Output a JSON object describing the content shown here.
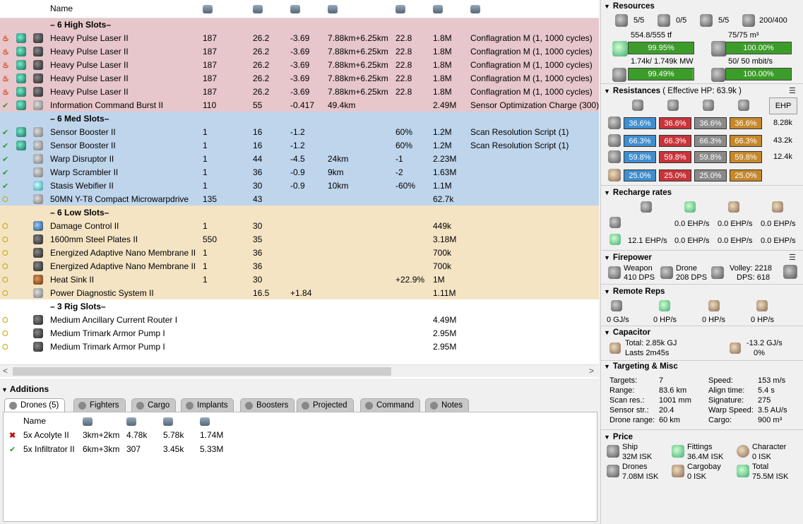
{
  "fit": {
    "columns": {
      "name": "Name"
    },
    "sections": {
      "high": "– 6 High Slots–",
      "med": "– 6 Med Slots–",
      "low": "– 6 Low Slots–",
      "rig": "– 3 Rig Slots–"
    },
    "high_rows": [
      {
        "state": "over",
        "name": "Heavy Pulse Laser II",
        "c1": "187",
        "c2": "26.2",
        "c3": "-3.69",
        "c4": "7.88km+6.25km",
        "c5": "22.8",
        "c6": "1.8M",
        "charge": "Conflagration M (1, 1000 cycles)"
      },
      {
        "state": "over",
        "name": "Heavy Pulse Laser II",
        "c1": "187",
        "c2": "26.2",
        "c3": "-3.69",
        "c4": "7.88km+6.25km",
        "c5": "22.8",
        "c6": "1.8M",
        "charge": "Conflagration M (1, 1000 cycles)"
      },
      {
        "state": "over",
        "name": "Heavy Pulse Laser II",
        "c1": "187",
        "c2": "26.2",
        "c3": "-3.69",
        "c4": "7.88km+6.25km",
        "c5": "22.8",
        "c6": "1.8M",
        "charge": "Conflagration M (1, 1000 cycles)"
      },
      {
        "state": "over",
        "name": "Heavy Pulse Laser II",
        "c1": "187",
        "c2": "26.2",
        "c3": "-3.69",
        "c4": "7.88km+6.25km",
        "c5": "22.8",
        "c6": "1.8M",
        "charge": "Conflagration M (1, 1000 cycles)"
      },
      {
        "state": "over",
        "name": "Heavy Pulse Laser II",
        "c1": "187",
        "c2": "26.2",
        "c3": "-3.69",
        "c4": "7.88km+6.25km",
        "c5": "22.8",
        "c6": "1.8M",
        "charge": "Conflagration M (1, 1000 cycles)"
      },
      {
        "state": "on",
        "name": "Information Command Burst II",
        "c1": "110",
        "c2": "55",
        "c3": "-0.417",
        "c4": "49.4km",
        "c5": "",
        "c6": "2.49M",
        "charge": "Sensor Optimization Charge (300)"
      }
    ],
    "med_rows": [
      {
        "state": "on",
        "name": "Sensor Booster II",
        "c1": "1",
        "c2": "16",
        "c3": "-1.2",
        "c4": "",
        "c5": "60%",
        "c6": "1.2M",
        "charge": "Scan Resolution Script (1)"
      },
      {
        "state": "on",
        "name": "Sensor Booster II",
        "c1": "1",
        "c2": "16",
        "c3": "-1.2",
        "c4": "",
        "c5": "60%",
        "c6": "1.2M",
        "charge": "Scan Resolution Script (1)"
      },
      {
        "state": "on",
        "name": "Warp Disruptor II",
        "c1": "1",
        "c2": "44",
        "c3": "-4.5",
        "c4": "24km",
        "c5": "-1",
        "c6": "2.23M",
        "charge": ""
      },
      {
        "state": "on",
        "name": "Warp Scrambler II",
        "c1": "1",
        "c2": "36",
        "c3": "-0.9",
        "c4": "9km",
        "c5": "-2",
        "c6": "1.63M",
        "charge": ""
      },
      {
        "state": "on",
        "name": "Stasis Webifier II",
        "c1": "1",
        "c2": "30",
        "c3": "-0.9",
        "c4": "10km",
        "c5": "-60%",
        "c6": "1.1M",
        "charge": ""
      },
      {
        "state": "off",
        "name": "50MN Y-T8 Compact Microwarpdrive",
        "c1": "135",
        "c2": "43",
        "c3": "",
        "c4": "",
        "c5": "",
        "c6": "62.7k",
        "charge": ""
      }
    ],
    "low_rows": [
      {
        "state": "off",
        "name": "Damage Control II",
        "c1": "1",
        "c2": "30",
        "c3": "",
        "c4": "",
        "c5": "",
        "c6": "449k"
      },
      {
        "state": "off",
        "name": "1600mm Steel Plates II",
        "c1": "550",
        "c2": "35",
        "c3": "",
        "c4": "",
        "c5": "",
        "c6": "3.18M"
      },
      {
        "state": "off",
        "name": "Energized Adaptive Nano Membrane II",
        "c1": "1",
        "c2": "36",
        "c3": "",
        "c4": "",
        "c5": "",
        "c6": "700k"
      },
      {
        "state": "off",
        "name": "Energized Adaptive Nano Membrane II",
        "c1": "1",
        "c2": "36",
        "c3": "",
        "c4": "",
        "c5": "",
        "c6": "700k"
      },
      {
        "state": "off",
        "name": "Heat Sink II",
        "c1": "1",
        "c2": "30",
        "c3": "",
        "c4": "",
        "c5": "+22.9%",
        "c6": "1M"
      },
      {
        "state": "off",
        "name": "Power Diagnostic System II",
        "c1": "",
        "c2": "16.5",
        "c3": "+1.84",
        "c4": "",
        "c5": "",
        "c6": "1.11M"
      }
    ],
    "rig_rows": [
      {
        "state": "off",
        "name": "Medium Ancillary Current Router I",
        "c6": "4.49M"
      },
      {
        "state": "off",
        "name": "Medium Trimark Armor Pump I",
        "c6": "2.95M"
      },
      {
        "state": "off",
        "name": "Medium Trimark Armor Pump I",
        "c6": "2.95M"
      }
    ]
  },
  "additions": {
    "title": "Additions",
    "tabs": [
      "Drones (5)",
      "Fighters",
      "Cargo",
      "Implants",
      "Boosters",
      "Projected",
      "Command",
      "Notes"
    ],
    "drone_header": "Name",
    "drones": [
      {
        "state": "x",
        "name": "5x Acolyte II",
        "range": "3km+2km",
        "v1": "4.78k",
        "v2": "5.78k",
        "price": "1.74M"
      },
      {
        "state": "on",
        "name": "5x Infiltrator II",
        "range": "6km+3km",
        "v1": "307",
        "v2": "3.45k",
        "price": "5.33M"
      }
    ]
  },
  "resources": {
    "title": "Resources",
    "turrets": "5/5",
    "launchers": "0/5",
    "calibration": "5/5",
    "drone_bay": "200/400",
    "cpu_text": "554.8/555 tf",
    "cpu_pct": "99.95%",
    "cpu_fill": 0.9995,
    "bandwidth_text": "75/75 m³",
    "bandwidth_pct": "100.00%",
    "bandwidth_fill": 1.0,
    "pg_text": "1.74k/ 1.749k MW",
    "pg_pct": "99.49%",
    "pg_fill": 0.9949,
    "drone_bw_text": "50/ 50 mbit/s",
    "drone_bw_pct": "100.00%",
    "drone_bw_fill": 1.0
  },
  "resistances": {
    "title": "Resistances",
    "ehp_label": "( Effective HP: 63.9k )",
    "ehp_button": "EHP",
    "rows": [
      {
        "em": "36.6%",
        "th": "36.6%",
        "ki": "36.6%",
        "ex": "36.6%",
        "hp": "8.28k"
      },
      {
        "em": "66.3%",
        "th": "66.3%",
        "ki": "66.3%",
        "ex": "66.3%",
        "hp": "43.2k"
      },
      {
        "em": "59.8%",
        "th": "59.8%",
        "ki": "59.8%",
        "ex": "59.8%",
        "hp": "12.4k"
      },
      {
        "em": "25.0%",
        "th": "25.0%",
        "ki": "25.0%",
        "ex": "25.0%",
        "hp": ""
      }
    ]
  },
  "recharge": {
    "title": "Recharge rates",
    "r1": [
      "0.0 EHP/s",
      "0.0 EHP/s",
      "0.0 EHP/s"
    ],
    "r2": [
      "12.1 EHP/s",
      "0.0 EHP/s",
      "0.0 EHP/s",
      "0.0 EHP/s"
    ]
  },
  "firepower": {
    "title": "Firepower",
    "weapon_label": "Weapon",
    "weapon_dps": "410 DPS",
    "drone_label": "Drone",
    "drone_dps": "208 DPS",
    "volley": "Volley: 2218",
    "dps": "DPS: 618"
  },
  "remote_reps": {
    "title": "Remote Reps",
    "values": [
      "0 GJ/s",
      "0 HP/s",
      "0 HP/s",
      "0 HP/s"
    ]
  },
  "capacitor": {
    "title": "Capacitor",
    "total": "Total: 2.85k GJ",
    "lasts": "Lasts 2m45s",
    "delta": "-13.2 GJ/s",
    "pct": "0%"
  },
  "targeting": {
    "title": "Targeting & Misc",
    "left": [
      {
        "k": "Targets:",
        "v": "7"
      },
      {
        "k": "Range:",
        "v": "83.6 km"
      },
      {
        "k": "Scan res.:",
        "v": "1001 mm"
      },
      {
        "k": "Sensor str.:",
        "v": "20.4"
      },
      {
        "k": "Drone range:",
        "v": "60 km"
      }
    ],
    "right": [
      {
        "k": "Speed:",
        "v": "153 m/s"
      },
      {
        "k": "Align time:",
        "v": "5.4 s"
      },
      {
        "k": "Signature:",
        "v": "275"
      },
      {
        "k": "Warp Speed:",
        "v": "3.5 AU/s"
      },
      {
        "k": "Cargo:",
        "v": "900 m³"
      }
    ]
  },
  "price": {
    "title": "Price",
    "ship_label": "Ship",
    "ship": "32M ISK",
    "fittings_label": "Fittings",
    "fittings": "36.4M ISK",
    "character_label": "Character",
    "character": "0 ISK",
    "drones_label": "Drones",
    "drones": "7.08M ISK",
    "cargobay_label": "Cargobay",
    "cargobay": "0 ISK",
    "total_label": "Total",
    "total": "75.5M ISK"
  }
}
